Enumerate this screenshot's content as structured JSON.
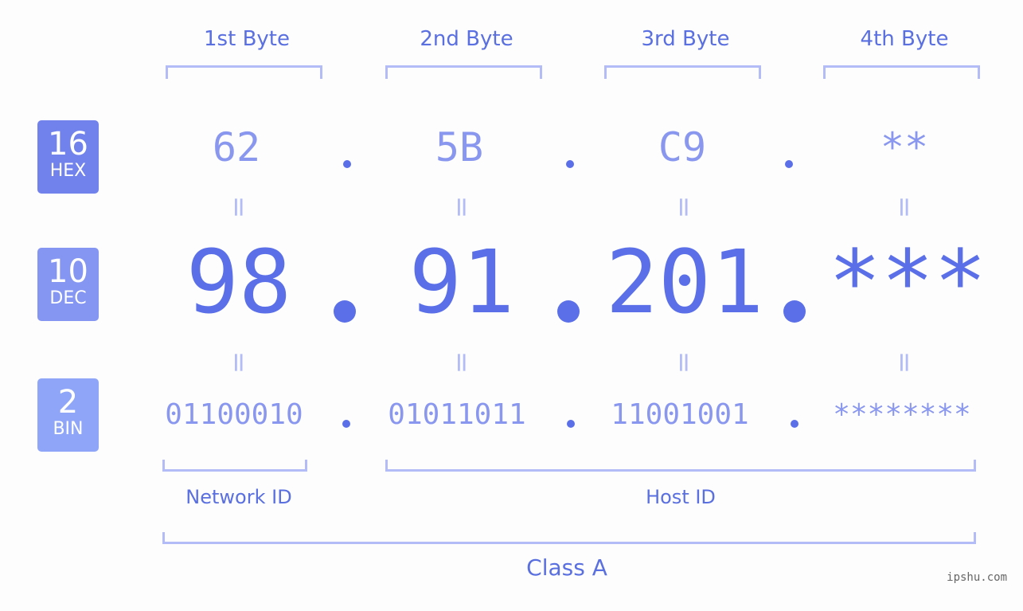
{
  "bytes": [
    {
      "label": "1st Byte",
      "hex": "62",
      "dec": "98",
      "bin": "01100010"
    },
    {
      "label": "2nd Byte",
      "hex": "5B",
      "dec": "91",
      "bin": "01011011"
    },
    {
      "label": "3rd Byte",
      "hex": "C9",
      "dec": "201",
      "bin": "11001001"
    },
    {
      "label": "4th Byte",
      "hex": "**",
      "dec": "***",
      "bin": "********"
    }
  ],
  "badges": {
    "hex": {
      "num": "16",
      "label": "HEX",
      "color": "#7282ec"
    },
    "dec": {
      "num": "10",
      "label": "DEC",
      "color": "#8595f2"
    },
    "bin": {
      "num": "2",
      "label": "BIN",
      "color": "#8fa6f8"
    }
  },
  "equals_symbol": "=",
  "groups": {
    "network": "Network ID",
    "host": "Host ID",
    "class": "Class A"
  },
  "watermark": "ipshu.com",
  "colors": {
    "accent": "#5a6fe8",
    "light": "#8a97ef",
    "bracket": "#b3bcf6"
  }
}
